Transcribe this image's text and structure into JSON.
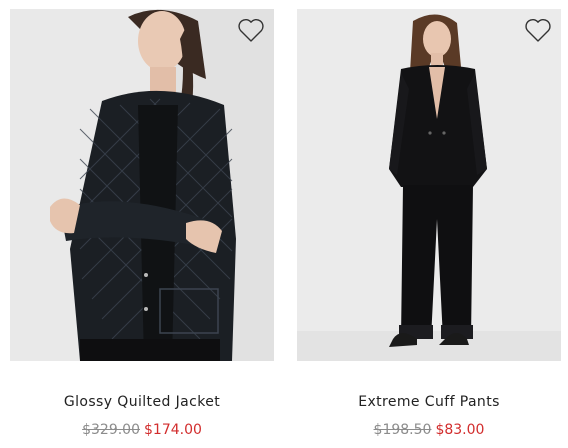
{
  "products": [
    {
      "name": "Glossy Quilted Jacket",
      "original_price": "$329.00",
      "sale_price": "$174.00",
      "wishlist_icon": "heart-outline-icon"
    },
    {
      "name": "Extreme Cuff Pants",
      "original_price": "$198.50",
      "sale_price": "$83.00",
      "wishlist_icon": "heart-outline-icon"
    }
  ],
  "colors": {
    "sale_price": "#d22d2d",
    "original_price": "#8c8c8c",
    "product_name": "#222222",
    "photo_background": "#e6e6e6"
  }
}
